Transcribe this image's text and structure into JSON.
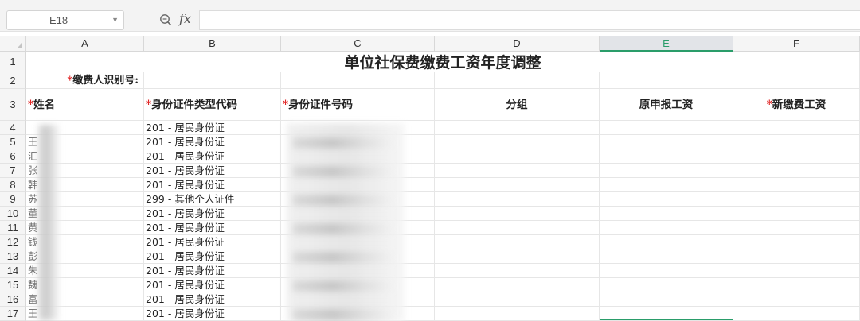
{
  "formula_bar": {
    "cell_ref": "E18",
    "fx_label": "fx",
    "formula": ""
  },
  "columns": [
    "A",
    "B",
    "C",
    "D",
    "E",
    "F"
  ],
  "selected_column": "E",
  "row_numbers": [
    "1",
    "2",
    "3",
    "4",
    "5",
    "6",
    "7",
    "8",
    "9",
    "10",
    "11",
    "12",
    "13",
    "14",
    "15",
    "16",
    "17"
  ],
  "sheet": {
    "title": "单位社保费缴费工资年度调整",
    "payer_id_label": "缴费人识别号:",
    "required_mark": "*",
    "headers": {
      "name": "姓名",
      "id_type_code": "身份证件类型代码",
      "id_number": "身份证件号码",
      "group": "分组",
      "original_wage": "原申报工资",
      "new_wage": "新缴费工资"
    },
    "rows": [
      {
        "name": "",
        "id_type": "201 - 居民身份证"
      },
      {
        "name": "王",
        "id_type": "201 - 居民身份证"
      },
      {
        "name": "汇",
        "id_type": "201 - 居民身份证"
      },
      {
        "name": "张",
        "id_type": "201 - 居民身份证"
      },
      {
        "name": "韩",
        "id_type": "201 - 居民身份证"
      },
      {
        "name": "苏",
        "id_type": "299 - 其他个人证件"
      },
      {
        "name": "董",
        "id_type": "201 - 居民身份证"
      },
      {
        "name": "黄",
        "id_type": "201 - 居民身份证"
      },
      {
        "name": "钱",
        "id_type": "201 - 居民身份证"
      },
      {
        "name": "彭",
        "id_type": "201 - 居民身份证"
      },
      {
        "name": "朱",
        "id_type": "201 - 居民身份证"
      },
      {
        "name": "魏",
        "id_type": "201 - 居民身份证"
      },
      {
        "name": "富",
        "id_type": "201 - 居民身份证"
      },
      {
        "name": "王",
        "id_type": "201 - 居民身份证"
      }
    ]
  }
}
